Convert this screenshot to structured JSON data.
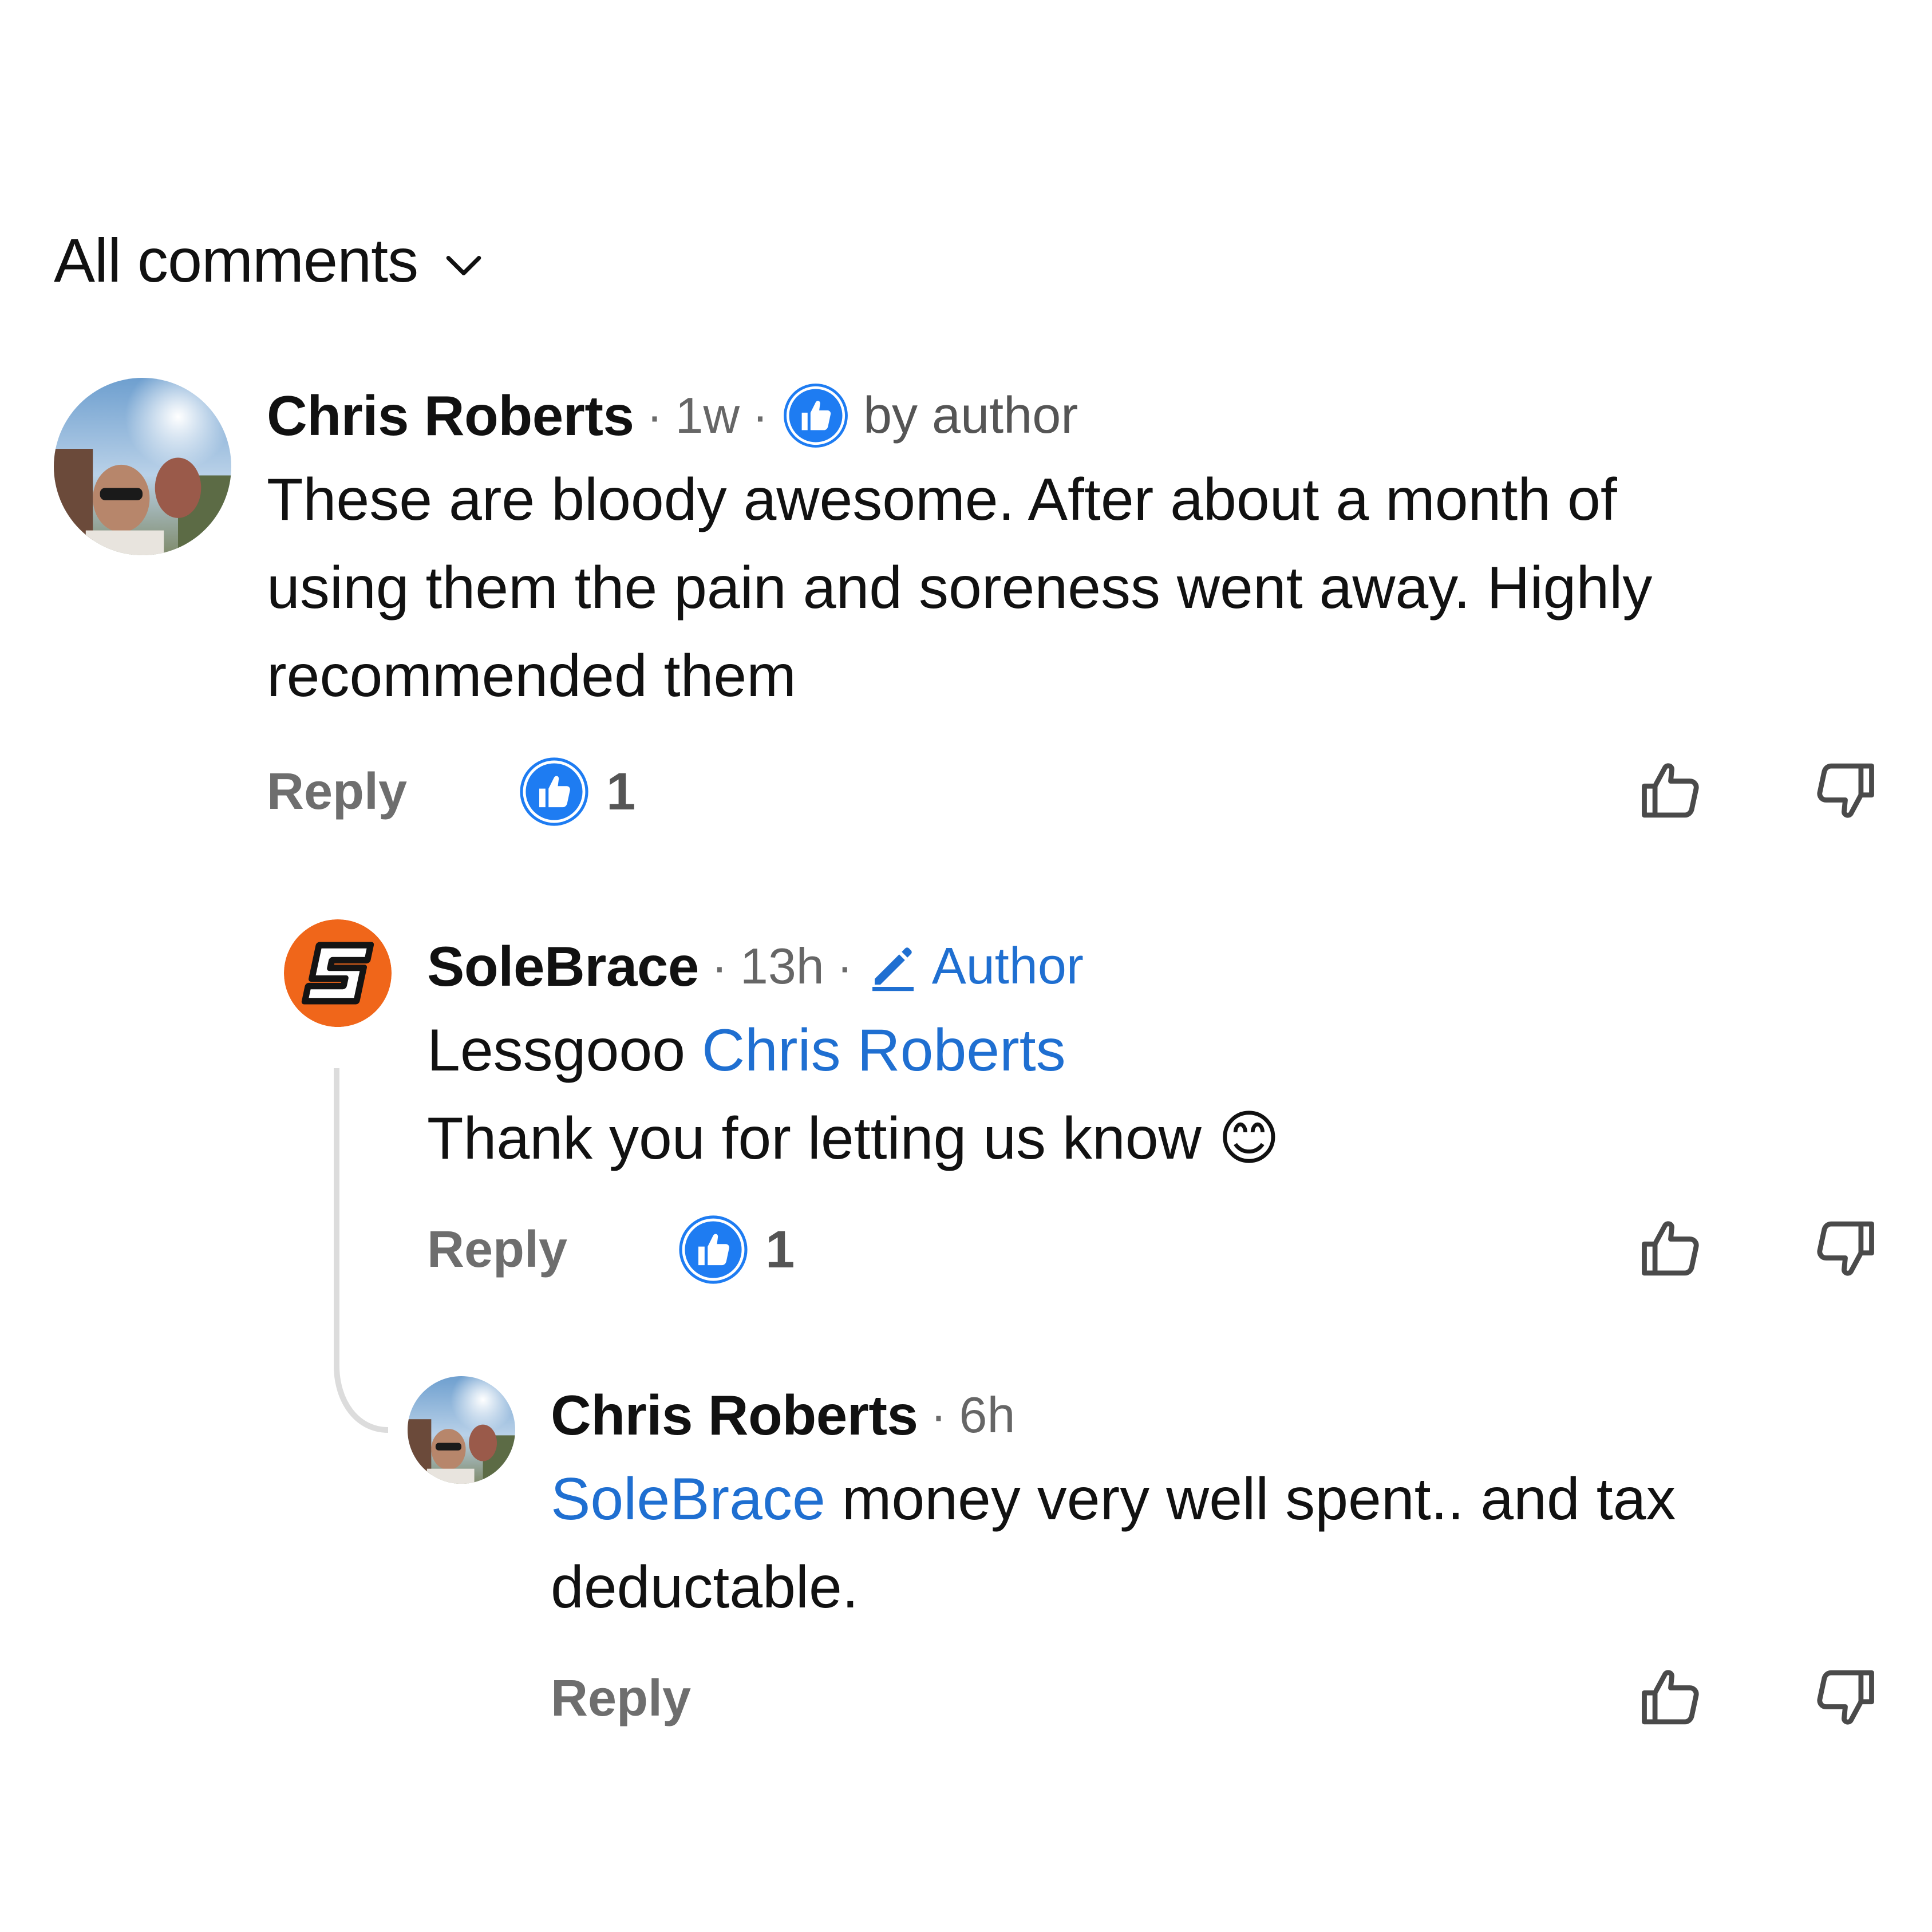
{
  "header": {
    "title": "All comments"
  },
  "comments": [
    {
      "author": "Chris Roberts",
      "separator": "·",
      "time": "1w",
      "liked_by_author_label": "by author",
      "body_lines": [
        "These are bloody awesome. After about a month of",
        "using them the pain and soreness went away. Highly",
        "recommended them"
      ],
      "reply_label": "Reply",
      "like_count": "1"
    },
    {
      "author": "SoleBrace",
      "separator": "·",
      "time": "13h",
      "author_tag": "Author",
      "body_lines": [
        {
          "prefix": "Lessgooo ",
          "mention": "Chris Roberts"
        },
        "Thank you for letting us know 😊"
      ],
      "reply_label": "Reply",
      "like_count": "1"
    },
    {
      "author": "Chris Roberts",
      "separator": "·",
      "time": "6h",
      "body_lines": [
        {
          "mention": "SoleBrace",
          "suffix": " money very well spent.. and tax"
        },
        "deductable."
      ],
      "reply_label": "Reply"
    }
  ],
  "colors": {
    "accent_blue": "#1f6fd1",
    "like_badge_blue": "#1e7cf2",
    "solebrace_orange": "#f0661a",
    "muted_gray": "#6e6e6e",
    "thread_line": "#dcdcdc"
  },
  "icons": {
    "header_dropdown": "chevron-down-icon",
    "like_badge": "thumbs-up-badge-icon",
    "author_edit": "pencil-icon",
    "like_button": "thumbs-up-outline-icon",
    "dislike_button": "thumbs-down-outline-icon"
  }
}
